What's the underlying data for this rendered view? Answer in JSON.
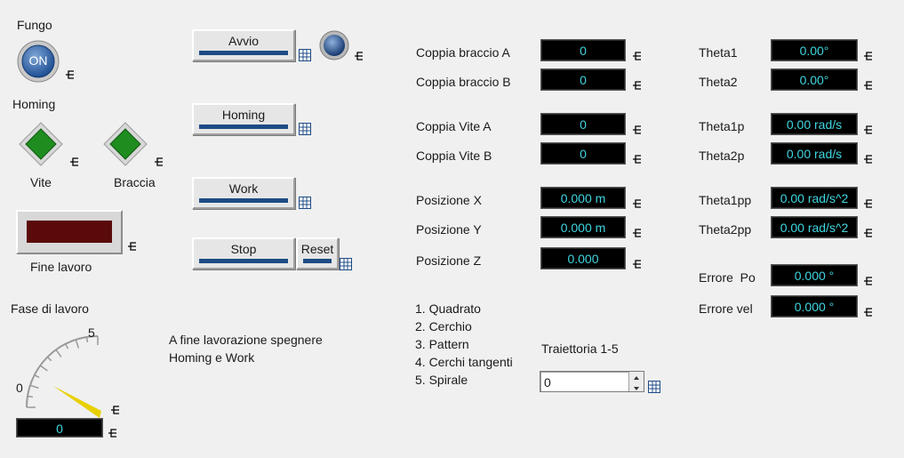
{
  "controls": {
    "fungo_label": "Fungo",
    "fungo_button": "ON",
    "homing_label": "Homing",
    "vite_label": "Vite",
    "braccia_label": "Braccia",
    "fine_lavoro_label": "Fine lavoro",
    "fase_label": "Fase di lavoro",
    "gauge_min": "0",
    "gauge_max": "5",
    "gauge_value": 0.7,
    "fase_value": "0"
  },
  "buttons": {
    "avvio": "Avvio",
    "homing": "Homing",
    "work": "Work",
    "stop": "Stop",
    "reset": "Reset"
  },
  "note": {
    "line1": "A fine lavorazione spegnere",
    "line2": "Homing e Work"
  },
  "measures_left": [
    {
      "label": "Coppia braccio A",
      "value": "0"
    },
    {
      "label": "Coppia braccio B",
      "value": "0"
    },
    {
      "label": "Coppia Vite A",
      "value": "0"
    },
    {
      "label": "Coppia Vite B",
      "value": "0"
    },
    {
      "label": "Posizione X",
      "value": "0.000 m"
    },
    {
      "label": "Posizione Y",
      "value": "0.000 m"
    },
    {
      "label": "Posizione Z",
      "value": "0.000"
    }
  ],
  "measures_right": [
    {
      "label": "Theta1",
      "value": "0.00°"
    },
    {
      "label": "Theta2",
      "value": "0.00°"
    },
    {
      "label": "Theta1p",
      "value": "0.00 rad/s"
    },
    {
      "label": "Theta2p",
      "value": "0.00 rad/s"
    },
    {
      "label": "Theta1pp",
      "value": "0.00 rad/s^2"
    },
    {
      "label": "Theta2pp",
      "value": "0.00 rad/s^2"
    },
    {
      "label": "Errore  Po",
      "value": "0.000 °"
    },
    {
      "label": "Errore vel",
      "value": "0.000 °"
    }
  ],
  "trajectories": {
    "items": [
      "1. Quadrato",
      "2. Cerchio",
      "3. Pattern",
      "4. Cerchi tangenti",
      "5. Spirale"
    ],
    "selector_label": "Traiettoria 1-5",
    "selector_value": "0"
  },
  "colors": {
    "indicator_text": "#3fd6e0",
    "led_green": "#1e8c1e",
    "fine_lavoro_led": "#5a0a0a",
    "gauge_needle": "#e8d000",
    "button_bar": "#1e4b85"
  }
}
